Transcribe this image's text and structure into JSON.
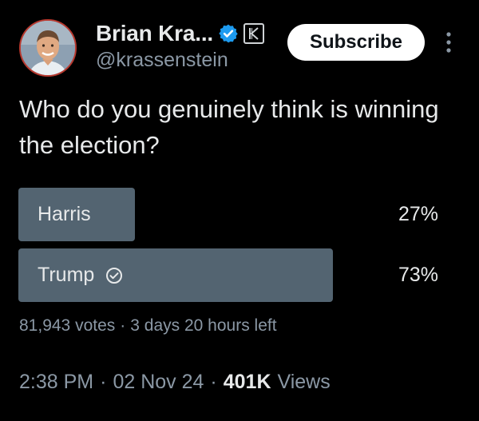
{
  "author": {
    "display_name": "Brian Kra...",
    "handle": "@krassenstein",
    "verified_icon": "verified-badge-icon",
    "affiliate_icon": "affiliate-k-icon"
  },
  "actions": {
    "subscribe_label": "Subscribe",
    "more_icon": "more-vertical-icon"
  },
  "tweet": {
    "text": "Who do you genuinely think is winning the election?"
  },
  "poll": {
    "options": [
      {
        "label": "Harris",
        "percent_text": "27%",
        "percent": 27,
        "selected": false
      },
      {
        "label": "Trump",
        "percent_text": "73%",
        "percent": 73,
        "selected": true
      }
    ],
    "votes": "81,943 votes",
    "separator": "·",
    "time_left": "3 days 20 hours left"
  },
  "meta": {
    "time": "2:38 PM",
    "separator1": "·",
    "date": "02 Nov 24",
    "separator2": "·",
    "views_count": "401K",
    "views_label": "Views"
  },
  "colors": {
    "background": "#000000",
    "poll_bar": "#536471",
    "verified": "#1d9bf0",
    "secondary_text": "#8b98a5",
    "primary_text": "#e7e9ea",
    "avatar_ring": "#b8392f"
  }
}
